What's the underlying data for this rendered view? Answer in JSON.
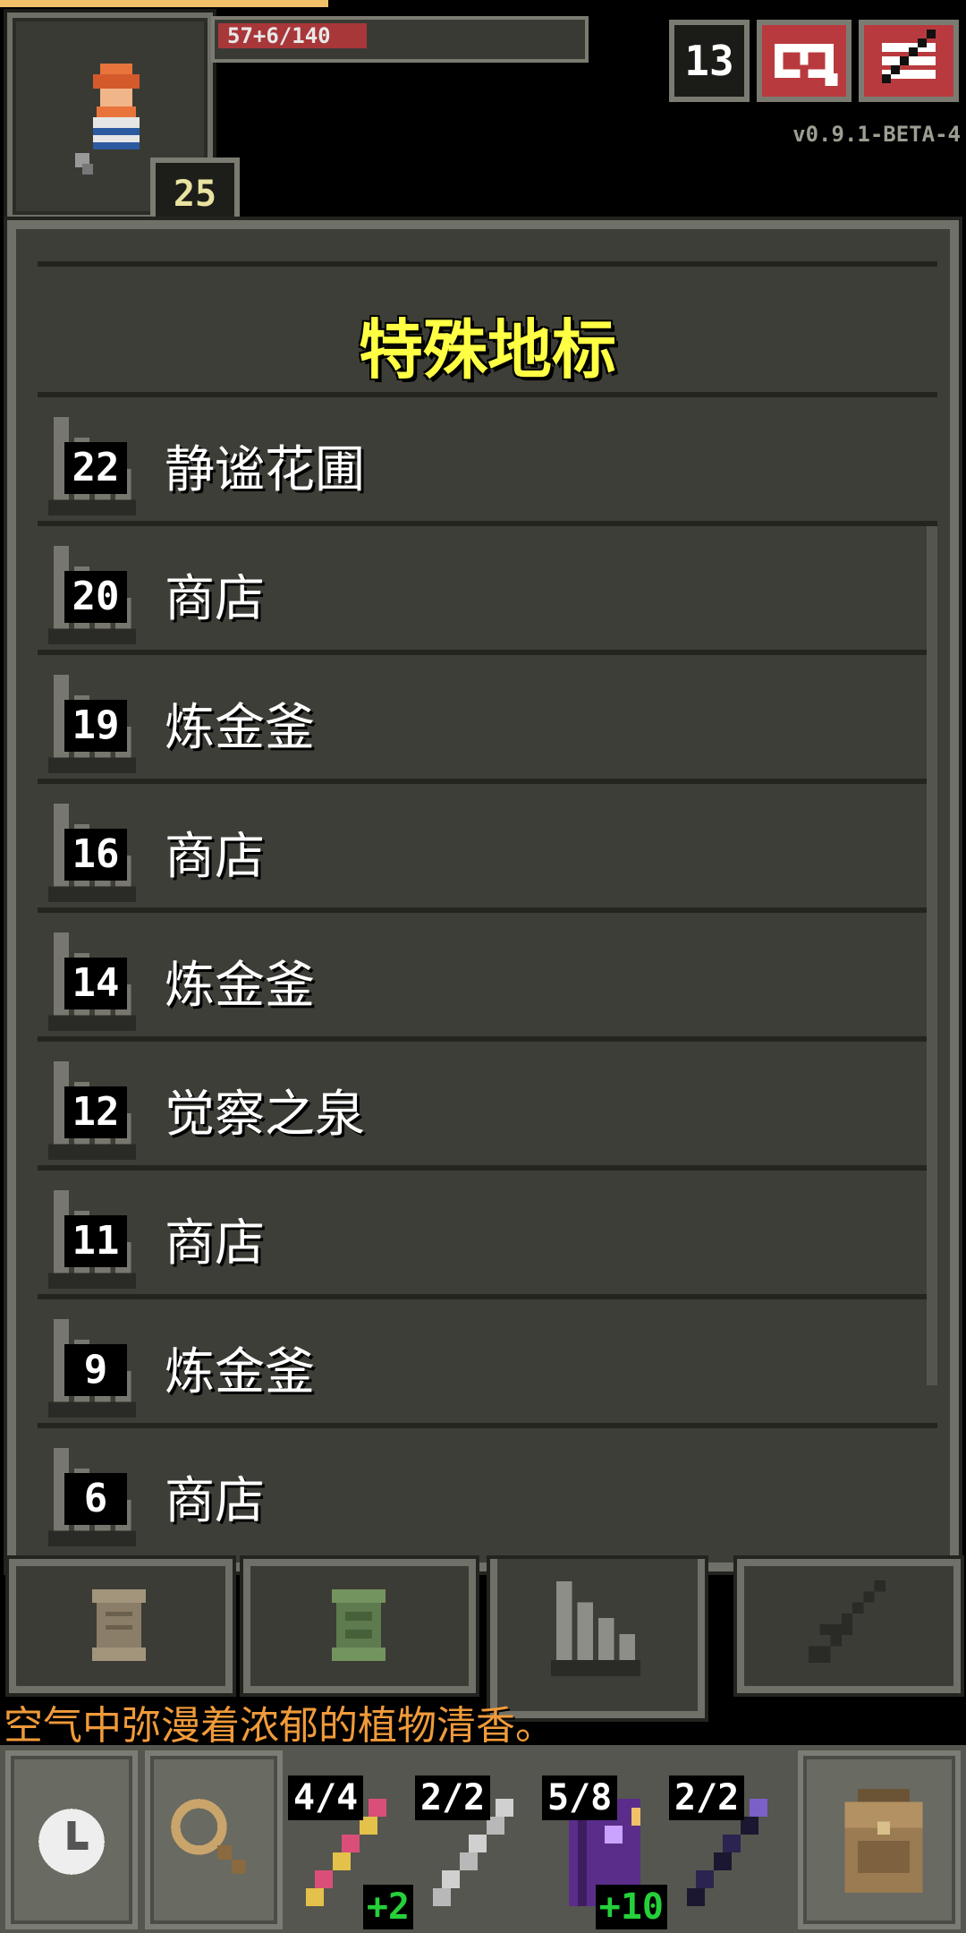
{
  "status": {
    "hp_text": "57+6/140",
    "hp_fraction": 0.41,
    "xp_fraction": 0.34,
    "level": "25",
    "depth": "13",
    "version": "v0.9.1-BETA-4"
  },
  "window": {
    "title": "特殊地标",
    "landmarks": [
      {
        "depth": "22",
        "name": "静谧花圃"
      },
      {
        "depth": "20",
        "name": "商店"
      },
      {
        "depth": "19",
        "name": "炼金釜"
      },
      {
        "depth": "16",
        "name": "商店"
      },
      {
        "depth": "14",
        "name": "炼金釜"
      },
      {
        "depth": "12",
        "name": "觉察之泉"
      },
      {
        "depth": "11",
        "name": "商店"
      },
      {
        "depth": "9",
        "name": "炼金釜"
      },
      {
        "depth": "6",
        "name": "商店"
      }
    ]
  },
  "tabs": [
    "scroll-tab-icon",
    "plant-tab-icon",
    "stairs-tab-icon",
    "sword-tab-icon"
  ],
  "message": "空气中弥漫着浓郁的植物清香。",
  "quickslots": [
    {
      "count": "4/4",
      "bonus": "+2",
      "icon": "wand-icon"
    },
    {
      "count": "2/2",
      "bonus": "",
      "icon": "silver-wand-icon"
    },
    {
      "count": "5/8",
      "bonus": "+10",
      "icon": "spellbook-icon"
    },
    {
      "count": "2/2",
      "bonus": "",
      "icon": "dark-wand-icon"
    }
  ]
}
